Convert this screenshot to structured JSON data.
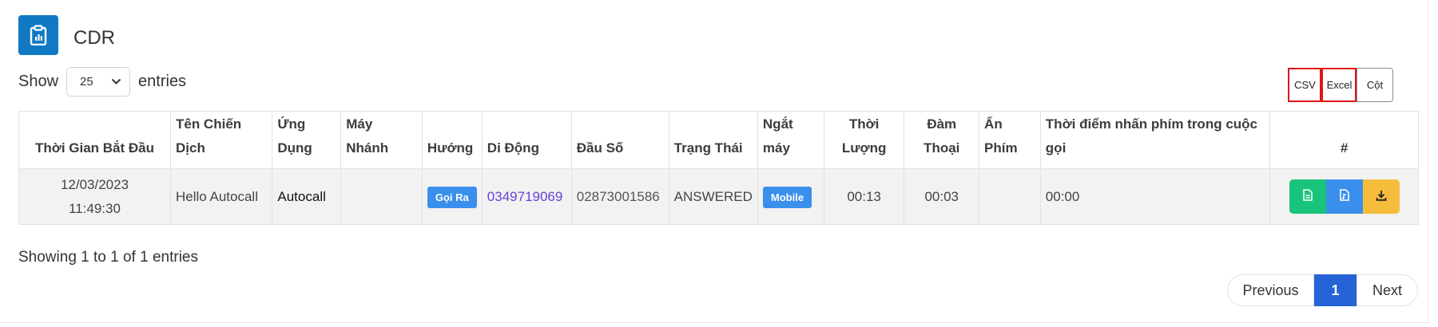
{
  "header": {
    "title": "CDR",
    "icon": "clipboard-chart-icon",
    "accent": "#1179c4"
  },
  "length_control": {
    "show_label": "Show",
    "selected": "25",
    "entries_label": "entries"
  },
  "export_buttons": {
    "csv": "CSV",
    "excel": "Excel",
    "columns": "Cột"
  },
  "table": {
    "columns": [
      "Thời Gian Bắt Đầu",
      "Tên Chiến Dịch",
      "Ứng Dụng",
      "Máy Nhánh",
      "Hướng",
      "Di Động",
      "Đầu Số",
      "Trạng Thái",
      "Ngắt máy",
      "Thời Lượng",
      "Đàm Thoại",
      "Ấn Phím",
      "Thời điểm nhấn phím trong cuộc gọi",
      "#"
    ],
    "rows": [
      {
        "start_date": "12/03/2023",
        "start_time": "11:49:30",
        "campaign": "Hello Autocall",
        "app": "Autocall",
        "extension": "",
        "direction": "Gọi Ra",
        "mobile": "0349719069",
        "prefix": "02873001586",
        "status": "ANSWERED",
        "hangup": "Mobile",
        "duration": "00:13",
        "talk": "00:03",
        "keypress": "",
        "keypress_time": "00:00"
      }
    ]
  },
  "info": "Showing 1 to 1 of 1 entries",
  "pagination": {
    "previous": "Previous",
    "current": "1",
    "next": "Next"
  }
}
